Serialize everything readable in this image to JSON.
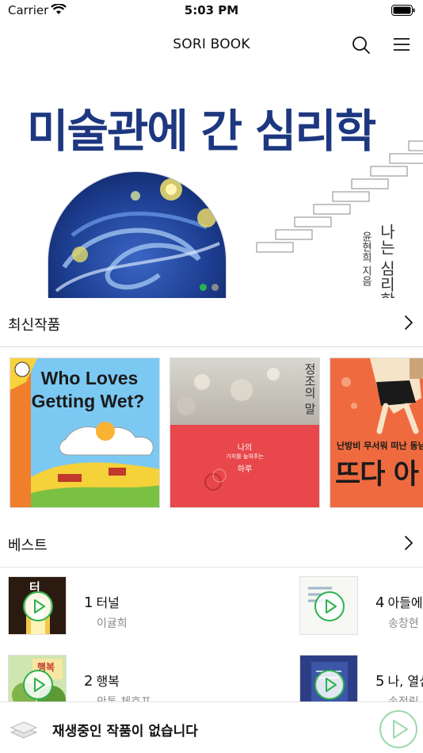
{
  "status_bar": {
    "carrier": "Carrier",
    "time": "5:03 PM"
  },
  "nav": {
    "title": "SORI BOOK",
    "search_icon": "search-icon",
    "menu_icon": "hamburger-menu-icon"
  },
  "banner": {
    "title": "미술관에 간 심리학",
    "author": "윤현희 지음",
    "subtitle": "나는 심리학",
    "page_count": 2,
    "active_page": 1,
    "accent_color": "#2bb24c",
    "title_color": "#1d3780"
  },
  "latest": {
    "title": "최신작품",
    "books": [
      {
        "title": "Who Loves Getting Wet?"
      },
      {
        "title_vertical": "정조의 말",
        "subtitle": "나의",
        "subtitle_line2": "가치를 높여주는",
        "subtitle_line3": "하루"
      },
      {
        "title": "뜨다 아",
        "subtitle": "난방비 무서워 떠난 동남아"
      }
    ]
  },
  "best": {
    "title": "베스트",
    "items": [
      {
        "rank": "1",
        "title": "터널",
        "author": "이귤희",
        "thumb_text": "터"
      },
      {
        "rank": "2",
        "title": "행복",
        "author": "안톤 체호프",
        "thumb_text": "행복"
      },
      {
        "rank": "4",
        "title": "아들에게",
        "author": "송창현"
      },
      {
        "rank": "5",
        "title": "나, 열심",
        "author": "송정림"
      }
    ]
  },
  "player": {
    "text": "재생중인 작품이 없습니다"
  }
}
